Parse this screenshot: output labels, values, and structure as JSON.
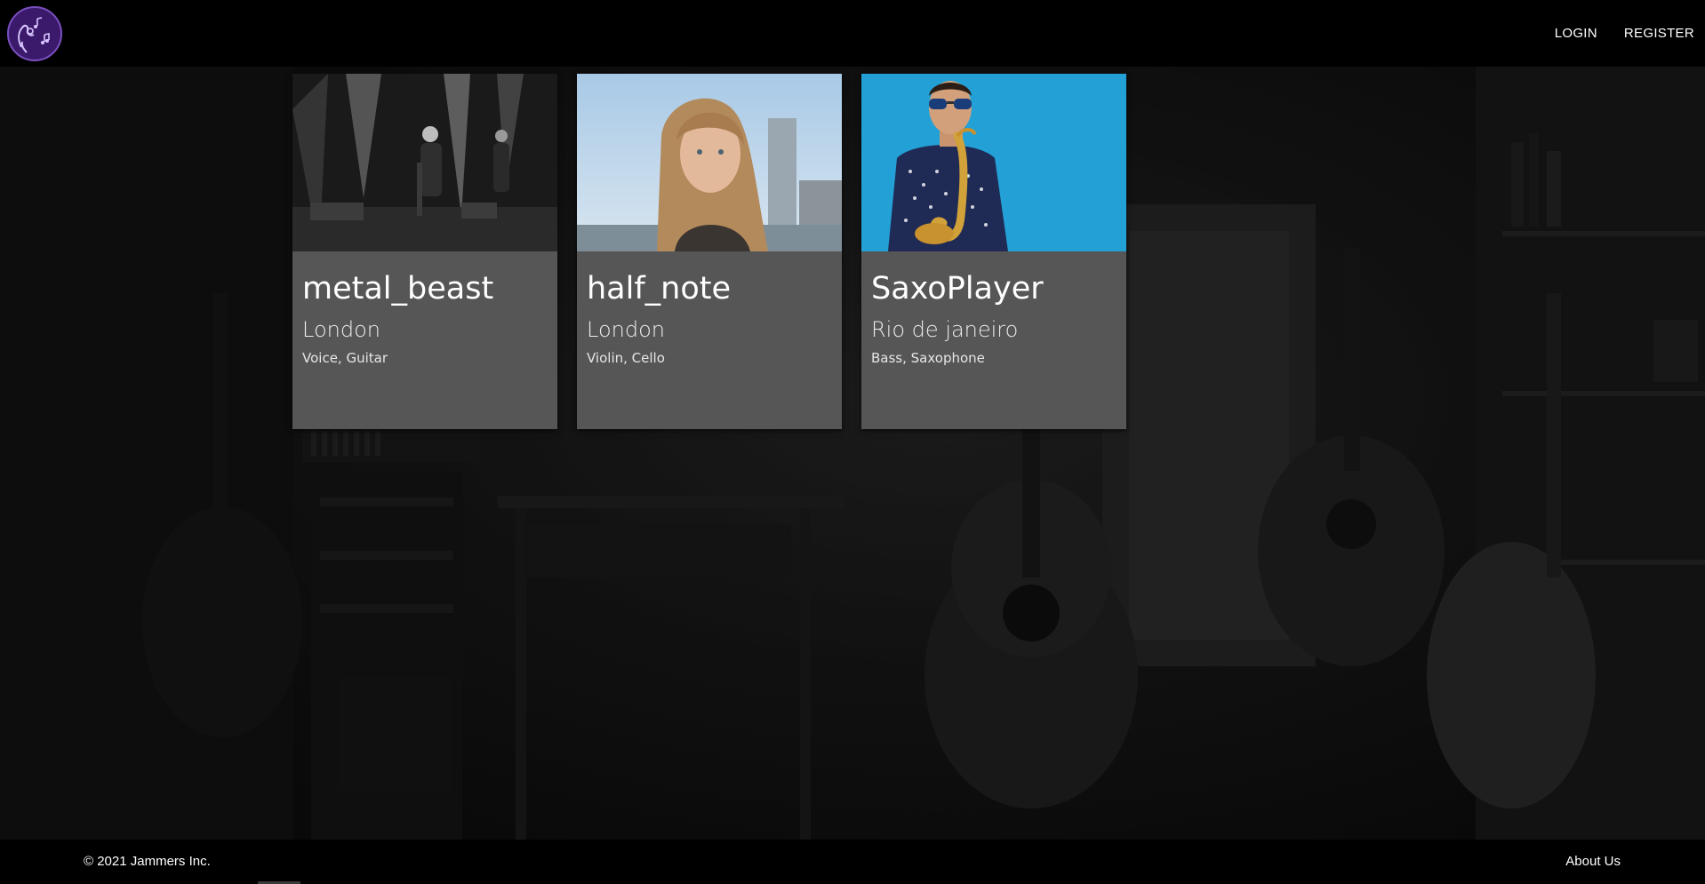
{
  "header": {
    "logo_icon": "music-hand-logo-icon",
    "nav": [
      {
        "label": "LOGIN"
      },
      {
        "label": "REGISTER"
      }
    ]
  },
  "cards": [
    {
      "name": "metal_beast",
      "city": "London",
      "instruments": "Voice, Guitar",
      "image": "concert-singer-photo"
    },
    {
      "name": "half_note",
      "city": "London",
      "instruments": "Violin, Cello",
      "image": "woman-portrait-photo"
    },
    {
      "name": "SaxoPlayer",
      "city": "Rio de janeiro",
      "instruments": "Bass, Saxophone",
      "image": "saxophone-player-photo"
    }
  ],
  "footer": {
    "copyright": "© 2021 Jammers Inc.",
    "about_label": "About Us"
  },
  "colors": {
    "navbar": "#000000",
    "card": "#565656",
    "logo_fill": "#3b1a6b",
    "logo_stroke": "#7a4fbf"
  }
}
